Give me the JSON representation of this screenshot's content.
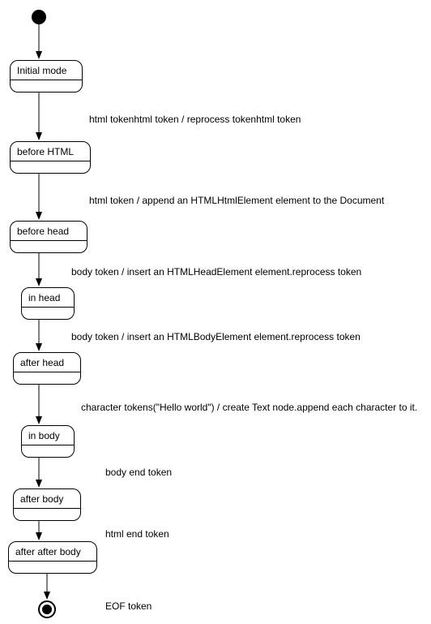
{
  "states": {
    "s0": "Initial mode",
    "s1": "before HTML",
    "s2": "before head",
    "s3": "in head",
    "s4": "after head",
    "s5": "in body",
    "s6": "after body",
    "s7": "after after body"
  },
  "transitions": {
    "t1": "html tokenhtml token / reprocess tokenhtml token",
    "t2": "html token / append an HTMLHtmlElement element to the Document",
    "t3": "body token / insert an HTMLHeadElement element.reprocess token",
    "t4": "body token / insert an HTMLBodyElement element.reprocess token",
    "t5": "character tokens(\"Hello world\") / create Text node.append each character to it.",
    "t6": "body end token",
    "t7": "html end token",
    "t8": "EOF token"
  },
  "chart_data": {
    "type": "state-diagram",
    "title": "",
    "initial": "start",
    "final": "end",
    "nodes": [
      {
        "id": "start",
        "kind": "initial"
      },
      {
        "id": "s0",
        "label": "Initial mode"
      },
      {
        "id": "s1",
        "label": "before HTML"
      },
      {
        "id": "s2",
        "label": "before head"
      },
      {
        "id": "s3",
        "label": "in head"
      },
      {
        "id": "s4",
        "label": "after head"
      },
      {
        "id": "s5",
        "label": "in body"
      },
      {
        "id": "s6",
        "label": "after body"
      },
      {
        "id": "s7",
        "label": "after after body"
      },
      {
        "id": "end",
        "kind": "final"
      }
    ],
    "edges": [
      {
        "from": "start",
        "to": "s0",
        "label": ""
      },
      {
        "from": "s0",
        "to": "s1",
        "label": "html tokenhtml token / reprocess tokenhtml token"
      },
      {
        "from": "s1",
        "to": "s2",
        "label": "html token / append an HTMLHtmlElement element to the Document"
      },
      {
        "from": "s2",
        "to": "s3",
        "label": "body token / insert an HTMLHeadElement element.reprocess token"
      },
      {
        "from": "s3",
        "to": "s4",
        "label": "body token / insert an HTMLBodyElement element.reprocess token"
      },
      {
        "from": "s4",
        "to": "s5",
        "label": "character tokens(\"Hello world\") / create Text node.append each character to it."
      },
      {
        "from": "s5",
        "to": "s6",
        "label": "body end token"
      },
      {
        "from": "s6",
        "to": "s7",
        "label": "html end token"
      },
      {
        "from": "s7",
        "to": "end",
        "label": "EOF token"
      }
    ]
  }
}
